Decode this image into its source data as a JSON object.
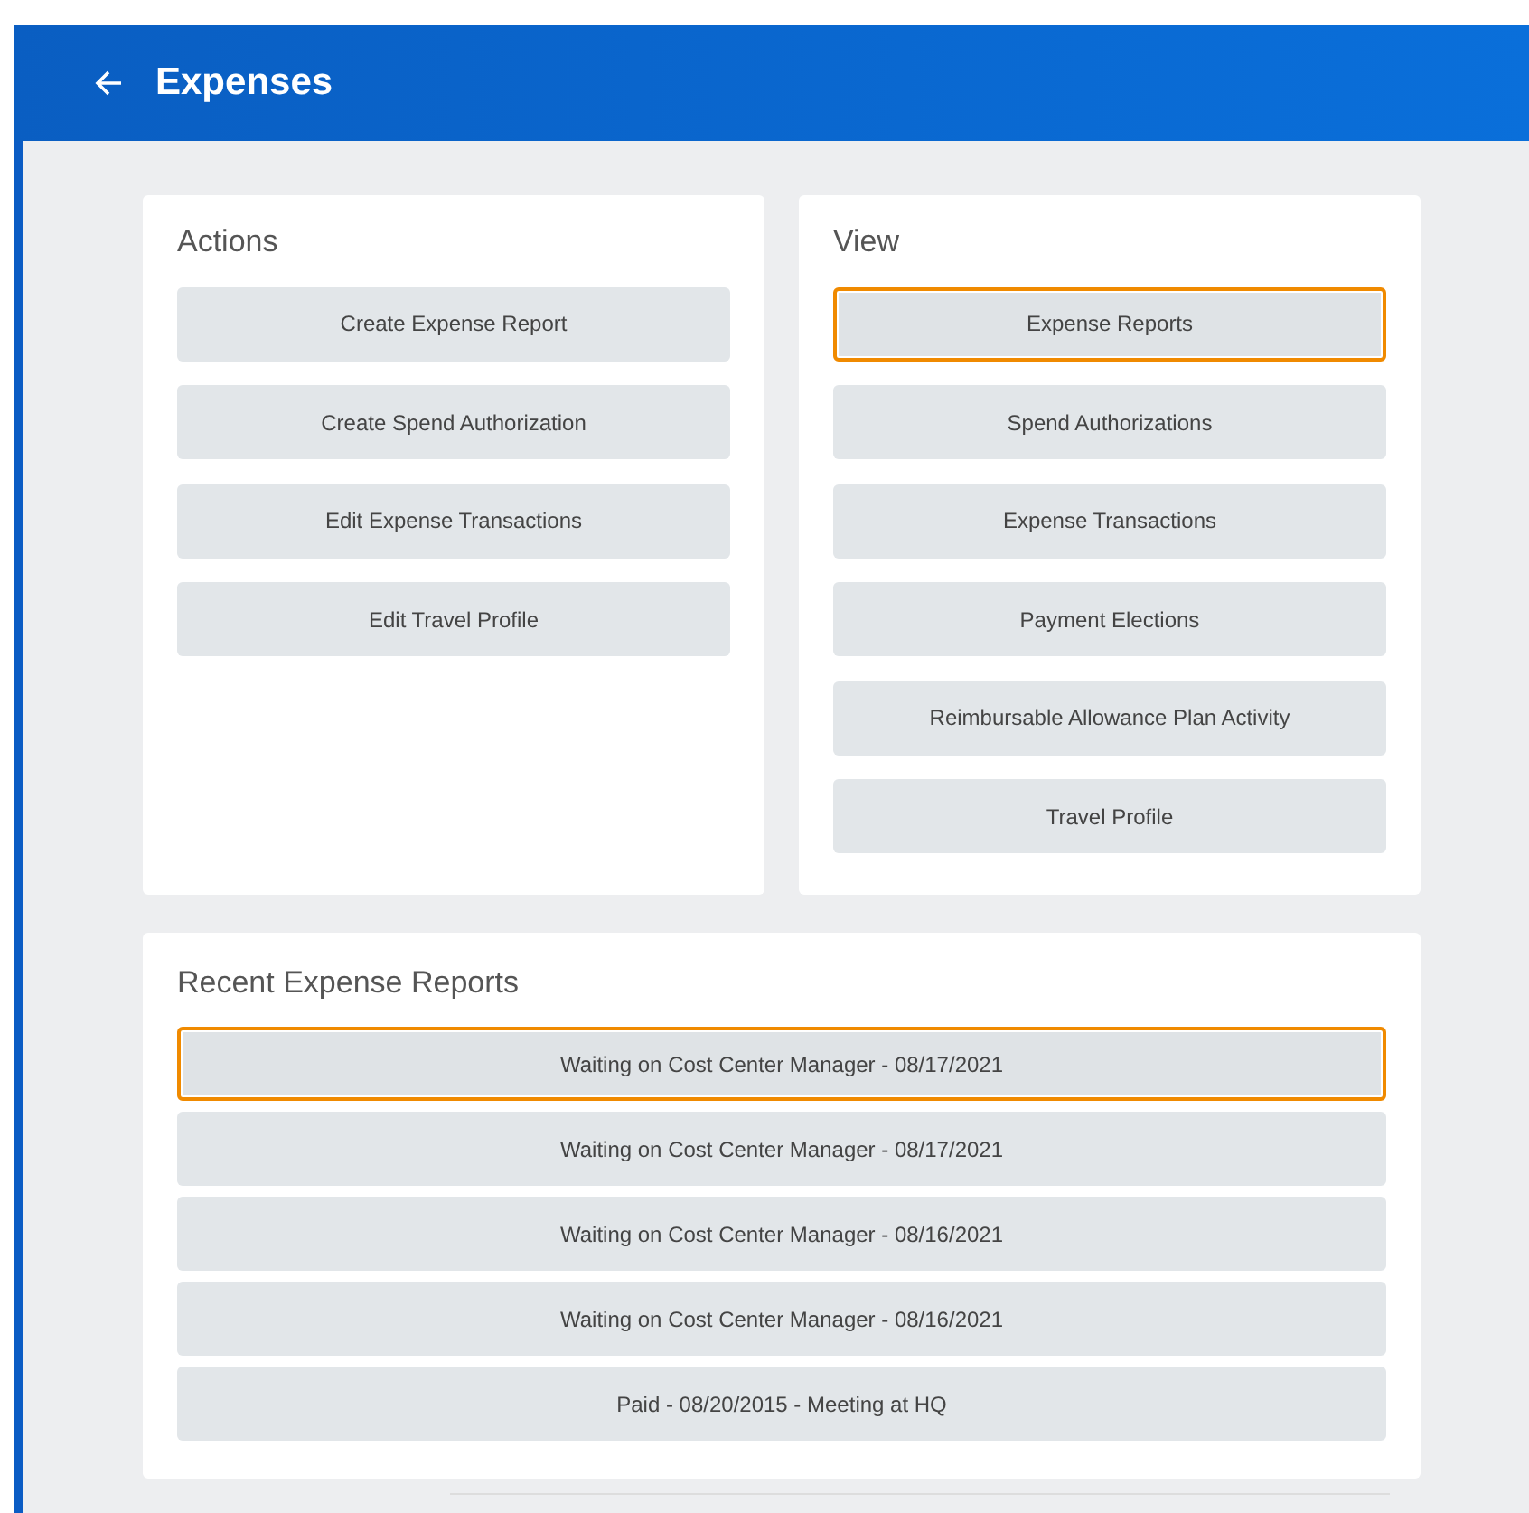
{
  "header": {
    "title": "Expenses"
  },
  "actions": {
    "title": "Actions",
    "buttons": [
      {
        "label": "Create Expense Report",
        "focused": false
      },
      {
        "label": "Create Spend Authorization",
        "focused": false
      },
      {
        "label": "Edit Expense Transactions",
        "focused": false
      },
      {
        "label": "Edit Travel Profile",
        "focused": false
      }
    ]
  },
  "view": {
    "title": "View",
    "buttons": [
      {
        "label": "Expense Reports",
        "focused": true
      },
      {
        "label": "Spend Authorizations",
        "focused": false
      },
      {
        "label": "Expense Transactions",
        "focused": false
      },
      {
        "label": "Payment Elections",
        "focused": false
      },
      {
        "label": "Reimbursable Allowance Plan Activity",
        "focused": false
      },
      {
        "label": "Travel Profile",
        "focused": false
      }
    ]
  },
  "recent": {
    "title": "Recent Expense Reports",
    "reports": [
      {
        "label": "Waiting on Cost Center Manager - 08/17/2021",
        "focused": true
      },
      {
        "label": "Waiting on Cost Center Manager - 08/17/2021",
        "focused": false
      },
      {
        "label": "Waiting on Cost Center Manager - 08/16/2021",
        "focused": false
      },
      {
        "label": "Waiting on Cost Center Manager - 08/16/2021",
        "focused": false
      },
      {
        "label": "Paid - 08/20/2015 - Meeting at HQ",
        "focused": false
      }
    ]
  }
}
